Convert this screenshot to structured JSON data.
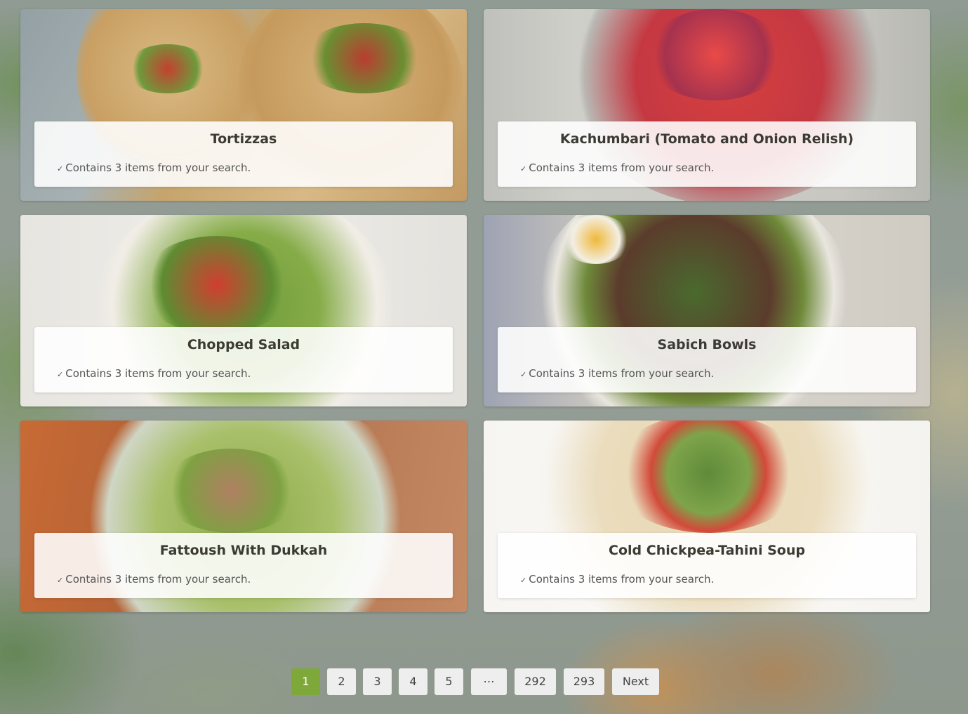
{
  "recipes": [
    {
      "title": "Tortizzas",
      "subtitle": "Contains 3 items from your search.",
      "image": "tortizzas-photo",
      "colors": [
        "#c9a46a",
        "#d8b985",
        "#b5523c",
        "#6e8f3d"
      ]
    },
    {
      "title": "Kachumbari (Tomato and Onion Relish)",
      "subtitle": "Contains 3 items from your search.",
      "image": "kachumbari-photo",
      "colors": [
        "#c8c8c2",
        "#c73a3e",
        "#e24a4a",
        "#9e2d4a"
      ]
    },
    {
      "title": "Chopped Salad",
      "subtitle": "Contains 3 items from your search.",
      "image": "chopped-salad-photo",
      "colors": [
        "#e9e7e2",
        "#6e9a3a",
        "#c93a2c",
        "#ece3cf"
      ]
    },
    {
      "title": "Sabich Bowls",
      "subtitle": "Contains 3 items from your search.",
      "image": "sabich-bowls-photo",
      "colors": [
        "#d6d2c8",
        "#3f5a2a",
        "#5a3a2a",
        "#e8c04a"
      ]
    },
    {
      "title": "Fattoush With Dukkah",
      "subtitle": "Contains 3 items from your search.",
      "image": "fattoush-photo",
      "colors": [
        "#a0542c",
        "#86a843",
        "#b08060",
        "#e2e0d8"
      ]
    },
    {
      "title": "Cold Chickpea-Tahini Soup",
      "subtitle": "Contains 3 items from your search.",
      "image": "chickpea-soup-photo",
      "colors": [
        "#f4f2ee",
        "#e8d8b4",
        "#5f8a3a",
        "#c9a24a"
      ]
    }
  ],
  "check_glyph": "✓",
  "pagination": {
    "pages": [
      "1",
      "2",
      "3",
      "4",
      "5",
      "…",
      "292",
      "293",
      "Next"
    ],
    "active": "1",
    "accent": "#7fa83a"
  }
}
